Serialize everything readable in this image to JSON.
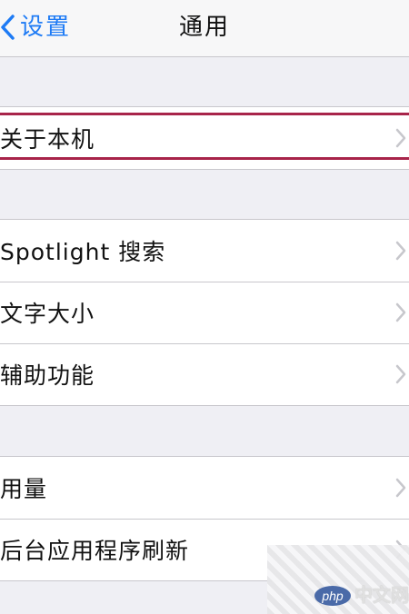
{
  "navbar": {
    "back_label": "设置",
    "title": "通用"
  },
  "groups": [
    {
      "items": [
        {
          "label": "关于本机"
        }
      ]
    },
    {
      "items": [
        {
          "label": "Spotlight 搜索"
        },
        {
          "label": "文字大小"
        },
        {
          "label": "辅助功能"
        }
      ]
    },
    {
      "items": [
        {
          "label": "用量"
        },
        {
          "label": "后台应用程序刷新"
        }
      ]
    }
  ],
  "watermark": {
    "badge": "php",
    "text": "中文网"
  },
  "colors": {
    "accent": "#1e7bf5",
    "highlight": "#a8244a",
    "background": "#efeff4",
    "separator": "#c8c7cc",
    "chevron": "#c7c7cc"
  },
  "icons": {
    "back": "chevron-left-icon",
    "disclosure": "chevron-right-icon"
  }
}
